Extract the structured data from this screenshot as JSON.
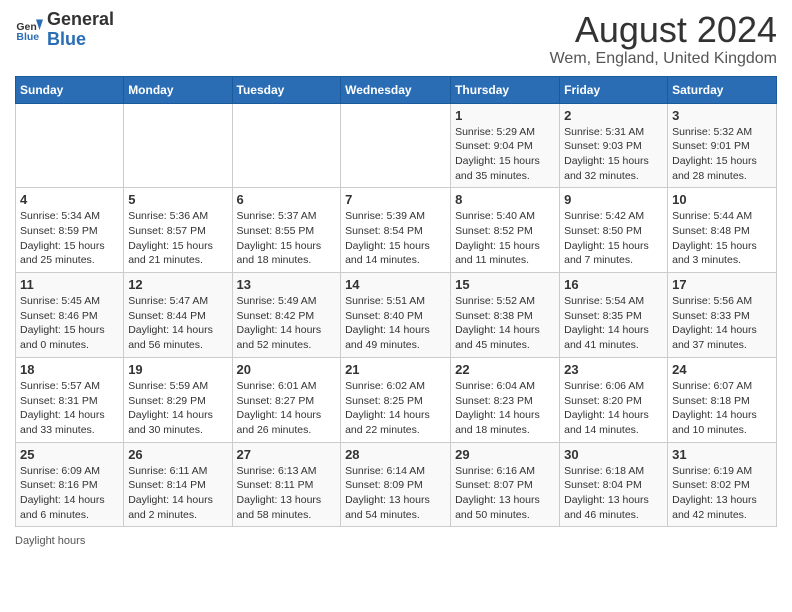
{
  "header": {
    "logo_general": "General",
    "logo_blue": "Blue",
    "month_year": "August 2024",
    "location": "Wem, England, United Kingdom"
  },
  "days_of_week": [
    "Sunday",
    "Monday",
    "Tuesday",
    "Wednesday",
    "Thursday",
    "Friday",
    "Saturday"
  ],
  "weeks": [
    [
      {
        "day": "",
        "detail": ""
      },
      {
        "day": "",
        "detail": ""
      },
      {
        "day": "",
        "detail": ""
      },
      {
        "day": "",
        "detail": ""
      },
      {
        "day": "1",
        "detail": "Sunrise: 5:29 AM\nSunset: 9:04 PM\nDaylight: 15 hours and 35 minutes."
      },
      {
        "day": "2",
        "detail": "Sunrise: 5:31 AM\nSunset: 9:03 PM\nDaylight: 15 hours and 32 minutes."
      },
      {
        "day": "3",
        "detail": "Sunrise: 5:32 AM\nSunset: 9:01 PM\nDaylight: 15 hours and 28 minutes."
      }
    ],
    [
      {
        "day": "4",
        "detail": "Sunrise: 5:34 AM\nSunset: 8:59 PM\nDaylight: 15 hours and 25 minutes."
      },
      {
        "day": "5",
        "detail": "Sunrise: 5:36 AM\nSunset: 8:57 PM\nDaylight: 15 hours and 21 minutes."
      },
      {
        "day": "6",
        "detail": "Sunrise: 5:37 AM\nSunset: 8:55 PM\nDaylight: 15 hours and 18 minutes."
      },
      {
        "day": "7",
        "detail": "Sunrise: 5:39 AM\nSunset: 8:54 PM\nDaylight: 15 hours and 14 minutes."
      },
      {
        "day": "8",
        "detail": "Sunrise: 5:40 AM\nSunset: 8:52 PM\nDaylight: 15 hours and 11 minutes."
      },
      {
        "day": "9",
        "detail": "Sunrise: 5:42 AM\nSunset: 8:50 PM\nDaylight: 15 hours and 7 minutes."
      },
      {
        "day": "10",
        "detail": "Sunrise: 5:44 AM\nSunset: 8:48 PM\nDaylight: 15 hours and 3 minutes."
      }
    ],
    [
      {
        "day": "11",
        "detail": "Sunrise: 5:45 AM\nSunset: 8:46 PM\nDaylight: 15 hours and 0 minutes."
      },
      {
        "day": "12",
        "detail": "Sunrise: 5:47 AM\nSunset: 8:44 PM\nDaylight: 14 hours and 56 minutes."
      },
      {
        "day": "13",
        "detail": "Sunrise: 5:49 AM\nSunset: 8:42 PM\nDaylight: 14 hours and 52 minutes."
      },
      {
        "day": "14",
        "detail": "Sunrise: 5:51 AM\nSunset: 8:40 PM\nDaylight: 14 hours and 49 minutes."
      },
      {
        "day": "15",
        "detail": "Sunrise: 5:52 AM\nSunset: 8:38 PM\nDaylight: 14 hours and 45 minutes."
      },
      {
        "day": "16",
        "detail": "Sunrise: 5:54 AM\nSunset: 8:35 PM\nDaylight: 14 hours and 41 minutes."
      },
      {
        "day": "17",
        "detail": "Sunrise: 5:56 AM\nSunset: 8:33 PM\nDaylight: 14 hours and 37 minutes."
      }
    ],
    [
      {
        "day": "18",
        "detail": "Sunrise: 5:57 AM\nSunset: 8:31 PM\nDaylight: 14 hours and 33 minutes."
      },
      {
        "day": "19",
        "detail": "Sunrise: 5:59 AM\nSunset: 8:29 PM\nDaylight: 14 hours and 30 minutes."
      },
      {
        "day": "20",
        "detail": "Sunrise: 6:01 AM\nSunset: 8:27 PM\nDaylight: 14 hours and 26 minutes."
      },
      {
        "day": "21",
        "detail": "Sunrise: 6:02 AM\nSunset: 8:25 PM\nDaylight: 14 hours and 22 minutes."
      },
      {
        "day": "22",
        "detail": "Sunrise: 6:04 AM\nSunset: 8:23 PM\nDaylight: 14 hours and 18 minutes."
      },
      {
        "day": "23",
        "detail": "Sunrise: 6:06 AM\nSunset: 8:20 PM\nDaylight: 14 hours and 14 minutes."
      },
      {
        "day": "24",
        "detail": "Sunrise: 6:07 AM\nSunset: 8:18 PM\nDaylight: 14 hours and 10 minutes."
      }
    ],
    [
      {
        "day": "25",
        "detail": "Sunrise: 6:09 AM\nSunset: 8:16 PM\nDaylight: 14 hours and 6 minutes."
      },
      {
        "day": "26",
        "detail": "Sunrise: 6:11 AM\nSunset: 8:14 PM\nDaylight: 14 hours and 2 minutes."
      },
      {
        "day": "27",
        "detail": "Sunrise: 6:13 AM\nSunset: 8:11 PM\nDaylight: 13 hours and 58 minutes."
      },
      {
        "day": "28",
        "detail": "Sunrise: 6:14 AM\nSunset: 8:09 PM\nDaylight: 13 hours and 54 minutes."
      },
      {
        "day": "29",
        "detail": "Sunrise: 6:16 AM\nSunset: 8:07 PM\nDaylight: 13 hours and 50 minutes."
      },
      {
        "day": "30",
        "detail": "Sunrise: 6:18 AM\nSunset: 8:04 PM\nDaylight: 13 hours and 46 minutes."
      },
      {
        "day": "31",
        "detail": "Sunrise: 6:19 AM\nSunset: 8:02 PM\nDaylight: 13 hours and 42 minutes."
      }
    ]
  ],
  "footer": {
    "daylight_label": "Daylight hours"
  }
}
